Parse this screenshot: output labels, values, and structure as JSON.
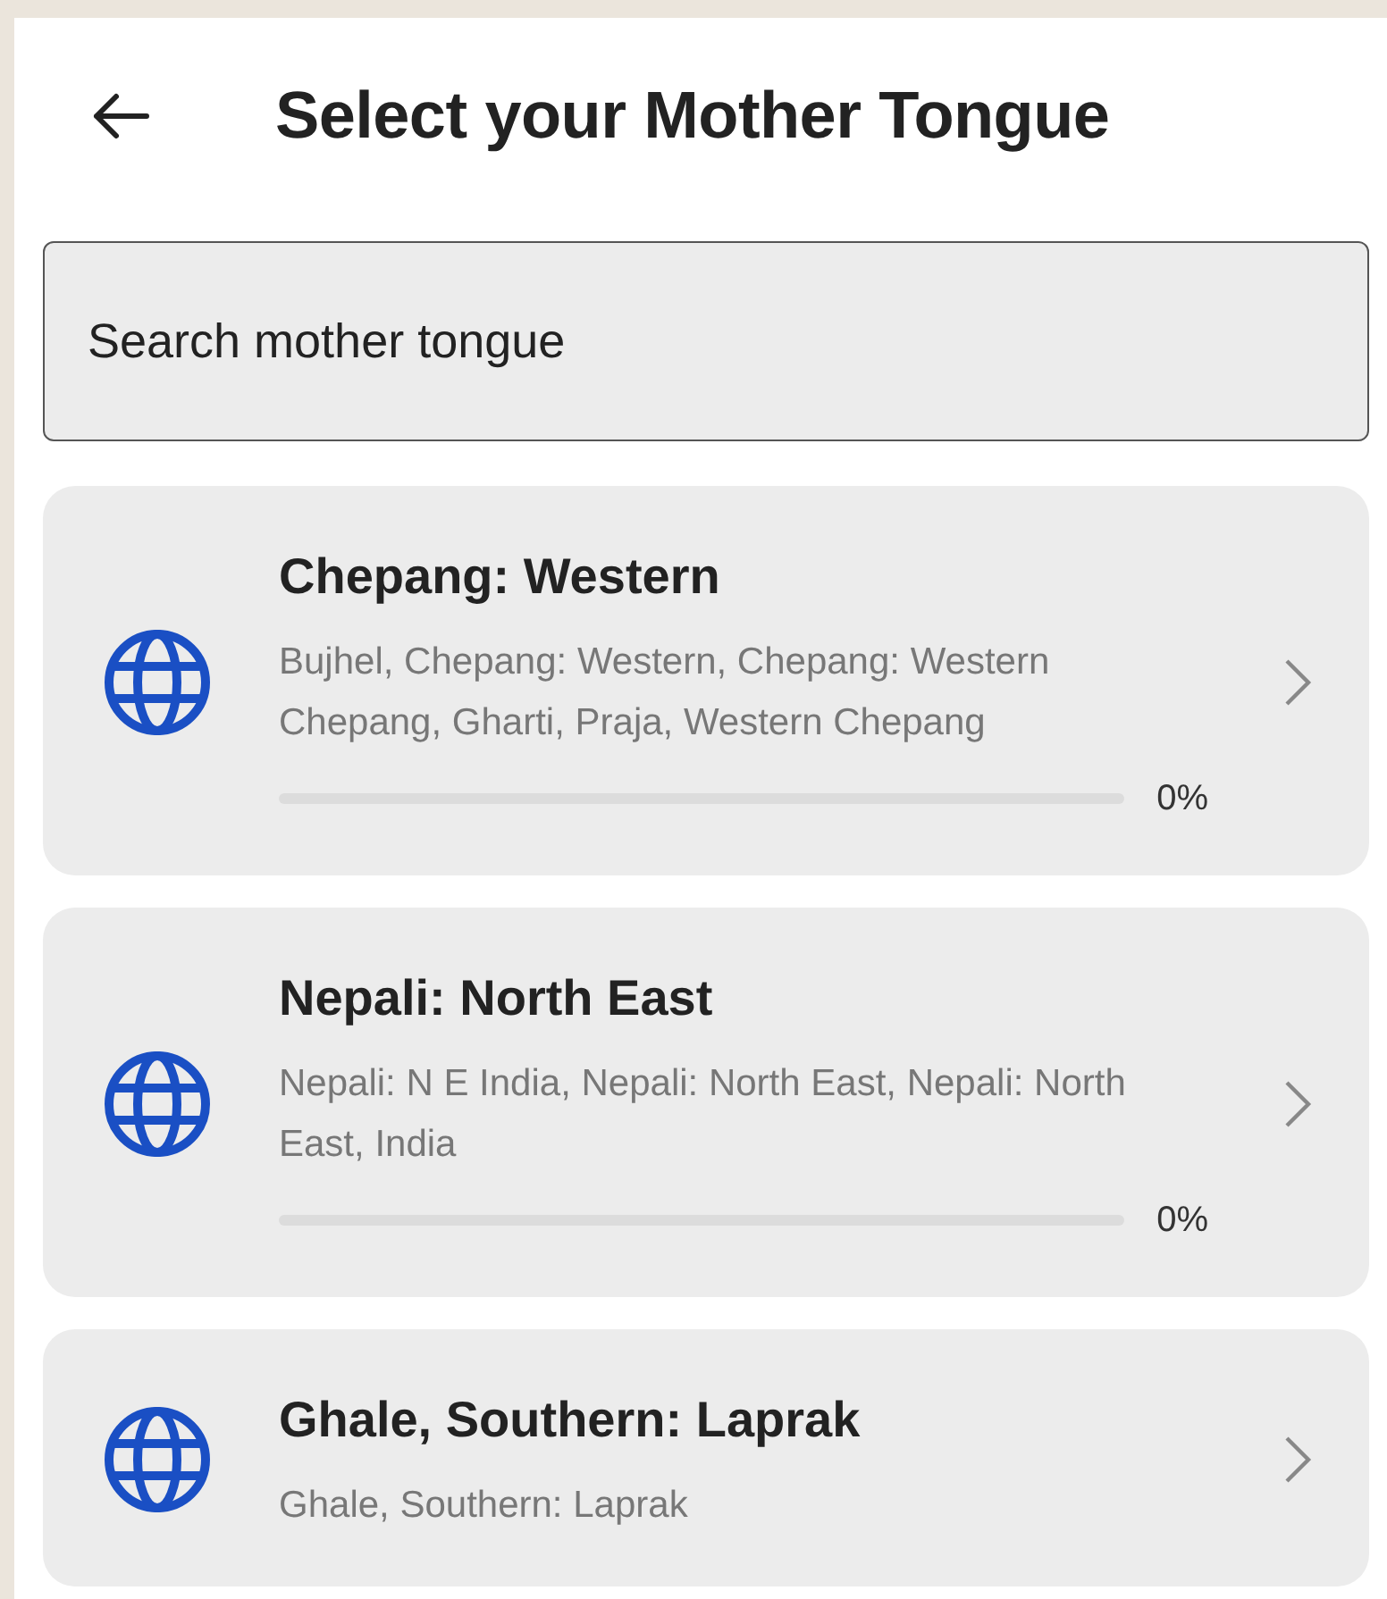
{
  "header": {
    "title": "Select your Mother Tongue"
  },
  "search": {
    "placeholder": "Search mother tongue"
  },
  "languages": [
    {
      "name": "Chepang: Western",
      "aliases": "Bujhel, Chepang: Western, Chepang: Western Chepang, Gharti, Praja, Western Chepang",
      "level": 0,
      "reading": "0%"
    },
    {
      "name": "Nepali: North East",
      "aliases": "Nepali: N E India, Nepali: North East, Nepali: North East, India",
      "level": 0,
      "reading": "0%"
    },
    {
      "name": "Ghale, Southern: Laprak",
      "aliases": "Ghale, Southern: Laprak"
    }
  ]
}
